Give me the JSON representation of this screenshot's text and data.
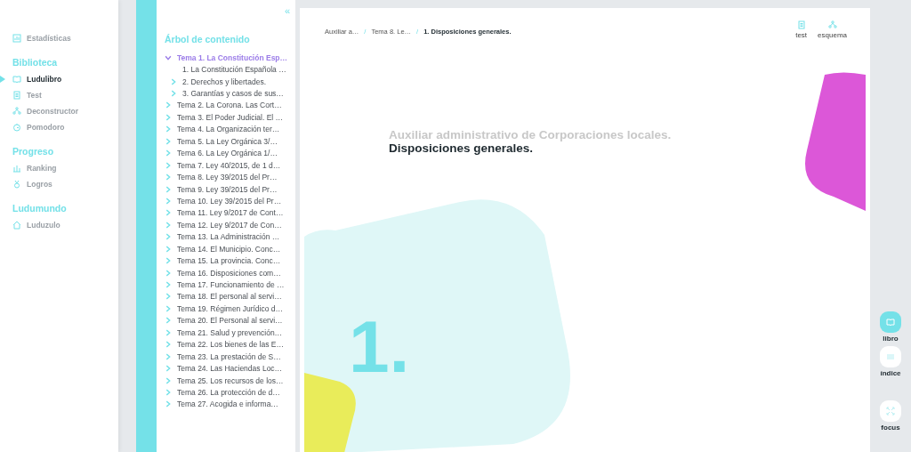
{
  "sidebar": {
    "items": [
      {
        "kind": "item",
        "label": "Estadísticas",
        "selected": false
      },
      {
        "kind": "section",
        "label": "Biblioteca"
      },
      {
        "kind": "item",
        "label": "Ludulibro",
        "selected": true
      },
      {
        "kind": "item",
        "label": "Test",
        "selected": false
      },
      {
        "kind": "item",
        "label": "Deconstructor",
        "selected": false
      },
      {
        "kind": "item",
        "label": "Pomodoro",
        "selected": false
      },
      {
        "kind": "section",
        "label": "Progreso"
      },
      {
        "kind": "item",
        "label": "Ranking",
        "selected": false
      },
      {
        "kind": "item",
        "label": "Logros",
        "selected": false
      },
      {
        "kind": "section",
        "label": "Ludumundo"
      },
      {
        "kind": "item",
        "label": "Luduzulo",
        "selected": false
      }
    ]
  },
  "tree": {
    "collapse_label": "«",
    "title": "Árbol de contenido",
    "items": [
      {
        "kind": "branch",
        "label": "Tema 1. La Constitución Esp…",
        "selected": true,
        "expanded": true,
        "children": [
          {
            "kind": "leaf",
            "label": "1. La Constitución Española …",
            "selected": false
          },
          {
            "kind": "branch",
            "label": "2. Derechos y libertades.",
            "selected": false,
            "expanded": false
          },
          {
            "kind": "branch",
            "label": "3. Garantías y casos de sus…",
            "selected": false,
            "expanded": false
          }
        ]
      },
      {
        "kind": "branch",
        "label": "Tema 2. La Corona. Las Cort…",
        "selected": false,
        "expanded": false
      },
      {
        "kind": "branch",
        "label": "Tema 3. El Poder Judicial. El …",
        "selected": false,
        "expanded": false
      },
      {
        "kind": "branch",
        "label": "Tema 4. La Organización ter…",
        "selected": false,
        "expanded": false
      },
      {
        "kind": "branch",
        "label": "Tema 5. La Ley Orgánica 3/…",
        "selected": false,
        "expanded": false
      },
      {
        "kind": "branch",
        "label": "Tema 6. La Ley Orgánica 1/…",
        "selected": false,
        "expanded": false
      },
      {
        "kind": "branch",
        "label": "Tema 7. Ley 40/2015, de 1 d…",
        "selected": false,
        "expanded": false
      },
      {
        "kind": "branch",
        "label": "Tema 8. Ley 39/2015 del Pr…",
        "selected": false,
        "expanded": false
      },
      {
        "kind": "branch",
        "label": "Tema 9. Ley 39/2015 del Pr…",
        "selected": false,
        "expanded": false
      },
      {
        "kind": "branch",
        "label": "Tema 10. Ley 39/2015 del Pr…",
        "selected": false,
        "expanded": false
      },
      {
        "kind": "branch",
        "label": "Tema 11. Ley 9/2017 de Cont…",
        "selected": false,
        "expanded": false
      },
      {
        "kind": "branch",
        "label": "Tema 12. Ley 9/2017 de Con…",
        "selected": false,
        "expanded": false
      },
      {
        "kind": "branch",
        "label": "Tema 13. La Administración …",
        "selected": false,
        "expanded": false
      },
      {
        "kind": "branch",
        "label": "Tema 14. El Municipio. Conc…",
        "selected": false,
        "expanded": false
      },
      {
        "kind": "branch",
        "label": "Tema 15. La provincia. Conc…",
        "selected": false,
        "expanded": false
      },
      {
        "kind": "branch",
        "label": "Tema 16. Disposiciones com…",
        "selected": false,
        "expanded": false
      },
      {
        "kind": "branch",
        "label": "Tema 17. Funcionamiento de …",
        "selected": false,
        "expanded": false
      },
      {
        "kind": "branch",
        "label": "Tema 18. El personal al servi…",
        "selected": false,
        "expanded": false
      },
      {
        "kind": "branch",
        "label": "Tema 19. Régimen Jurídico d…",
        "selected": false,
        "expanded": false
      },
      {
        "kind": "branch",
        "label": "Tema 20. El Personal al servi…",
        "selected": false,
        "expanded": false
      },
      {
        "kind": "branch",
        "label": "Tema 21. Salud y prevención…",
        "selected": false,
        "expanded": false
      },
      {
        "kind": "branch",
        "label": "Tema 22. Los bienes de las E…",
        "selected": false,
        "expanded": false
      },
      {
        "kind": "branch",
        "label": "Tema 23. La prestación de S…",
        "selected": false,
        "expanded": false
      },
      {
        "kind": "branch",
        "label": "Tema 24. Las Haciendas Loc…",
        "selected": false,
        "expanded": false
      },
      {
        "kind": "branch",
        "label": "Tema 25. Los recursos de los…",
        "selected": false,
        "expanded": false
      },
      {
        "kind": "branch",
        "label": "Tema 26. La protección de d…",
        "selected": false,
        "expanded": false
      },
      {
        "kind": "branch",
        "label": "Tema 27. Acogida e informa…",
        "selected": false,
        "expanded": false
      }
    ]
  },
  "breadcrumb": {
    "separator": "/",
    "items": [
      "Auxiliar a…",
      "Tema 8. Le…",
      "1. Disposiciones generales."
    ]
  },
  "tools": [
    "test",
    "esquema"
  ],
  "page": {
    "subtitle": "Auxiliar administrativo de Corporaciones locales.",
    "title": "Disposiciones generales.",
    "number": "1."
  },
  "rail": [
    {
      "label": "libro",
      "selected": true
    },
    {
      "label": "índice",
      "selected": false
    },
    {
      "label": "focus",
      "selected": false
    }
  ]
}
